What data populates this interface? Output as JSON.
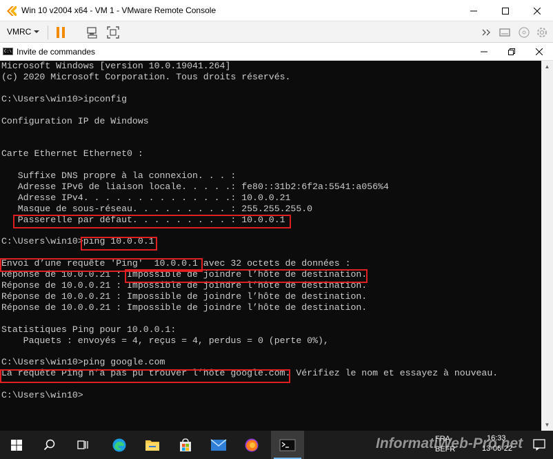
{
  "vmware": {
    "title": "Win 10 v2004 x64 - VM 1 - VMware Remote Console",
    "menu_label": "VMRC"
  },
  "cmd": {
    "title": "Invite de commandes"
  },
  "console": {
    "lines": [
      "Microsoft Windows [version 10.0.19041.264]",
      "(c) 2020 Microsoft Corporation. Tous droits réservés.",
      "",
      "C:\\Users\\win10>ipconfig",
      "",
      "Configuration IP de Windows",
      "",
      "",
      "Carte Ethernet Ethernet0 :",
      "",
      "   Suffixe DNS propre à la connexion. . . :",
      "   Adresse IPv6 de liaison locale. . . . .: fe80::31b2:6f2a:5541:a056%4",
      "   Adresse IPv4. . . . . . . . . . . . . .: 10.0.0.21",
      "   Masque de sous-réseau. . . . . . . . . : 255.255.255.0",
      "   Passerelle par défaut. . . . . . . . . : 10.0.0.1",
      "",
      "C:\\Users\\win10>ping 10.0.0.1",
      "",
      "Envoi d’une requête 'Ping'  10.0.0.1 avec 32 octets de données :",
      "Réponse de 10.0.0.21 : Impossible de joindre l’hôte de destination.",
      "Réponse de 10.0.0.21 : Impossible de joindre l’hôte de destination.",
      "Réponse de 10.0.0.21 : Impossible de joindre l’hôte de destination.",
      "Réponse de 10.0.0.21 : Impossible de joindre l’hôte de destination.",
      "",
      "Statistiques Ping pour 10.0.0.1:",
      "    Paquets : envoyés = 4, reçus = 4, perdus = 0 (perte 0%),",
      "",
      "C:\\Users\\win10>ping google.com",
      "La requête Ping n’a pas pu trouver l’hôte google.com. Vérifiez le nom et essayez à nouveau.",
      "",
      "C:\\Users\\win10>"
    ]
  },
  "taskbar": {
    "lang_line1": "FRA",
    "lang_line2": "BEFR",
    "time": "16:33",
    "date": "13-06-22"
  },
  "watermark": "InformatiWeb-Pro.net",
  "colors": {
    "console_bg": "#0c0c0c",
    "console_text": "#cccccc",
    "highlight": "#e02020",
    "pause_orange": "#f38b00",
    "taskbar_bg": "#1c1c1c"
  }
}
